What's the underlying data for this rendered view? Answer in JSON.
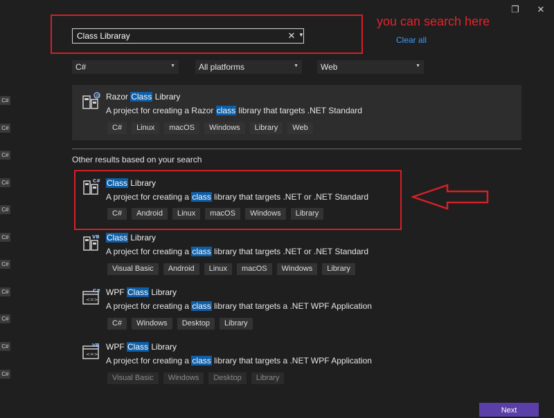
{
  "window": {
    "restore_icon": "restore-icon",
    "close_icon": "close-icon"
  },
  "annotations": {
    "search_hint": "you can search here",
    "arrow": "red-arrow"
  },
  "search": {
    "value": "Class Libraray",
    "clear_label": "Clear all"
  },
  "filters": [
    {
      "value": "C#"
    },
    {
      "value": "All platforms"
    },
    {
      "value": "Web"
    }
  ],
  "left_strip_label": "C#",
  "templates": [
    {
      "lang_badge": "",
      "title_pre": "Razor ",
      "title_hl": "Class",
      "title_post": " Library",
      "desc_pre": "A project for creating a Razor ",
      "desc_hl": "class",
      "desc_post": " library that targets .NET Standard",
      "tags": [
        "C#",
        "Linux",
        "macOS",
        "Windows",
        "Library",
        "Web"
      ]
    },
    {
      "lang_badge": "C#",
      "title_pre": "",
      "title_hl": "Class",
      "title_post": " Library",
      "desc_pre": "A project for creating a ",
      "desc_hl": "class",
      "desc_post": " library that targets .NET or .NET Standard",
      "tags": [
        "C#",
        "Android",
        "Linux",
        "macOS",
        "Windows",
        "Library"
      ]
    },
    {
      "lang_badge": "VB",
      "title_pre": "",
      "title_hl": "Class",
      "title_post": " Library",
      "desc_pre": "A project for creating a ",
      "desc_hl": "class",
      "desc_post": " library that targets .NET or .NET Standard",
      "tags": [
        "Visual Basic",
        "Android",
        "Linux",
        "macOS",
        "Windows",
        "Library"
      ]
    },
    {
      "lang_badge": "C#",
      "title_pre": "WPF ",
      "title_hl": "Class",
      "title_post": " Library",
      "desc_pre": "A project for creating a ",
      "desc_hl": "class",
      "desc_post": " library that targets a .NET WPF Application",
      "tags": [
        "C#",
        "Windows",
        "Desktop",
        "Library"
      ]
    },
    {
      "lang_badge": "VB",
      "title_pre": "WPF ",
      "title_hl": "Class",
      "title_post": " Library",
      "desc_pre": "A project for creating a ",
      "desc_hl": "class",
      "desc_post": " library that targets a .NET WPF Application",
      "tags": [
        "Visual Basic",
        "Windows",
        "Desktop",
        "Library"
      ]
    }
  ],
  "section_label": "Other results based on your search",
  "next_label": "Next",
  "colors": {
    "accent": "#0f5fa8",
    "annotation_red": "#d42027",
    "link_blue": "#3f9cff",
    "next_button": "#5b3fa8"
  }
}
